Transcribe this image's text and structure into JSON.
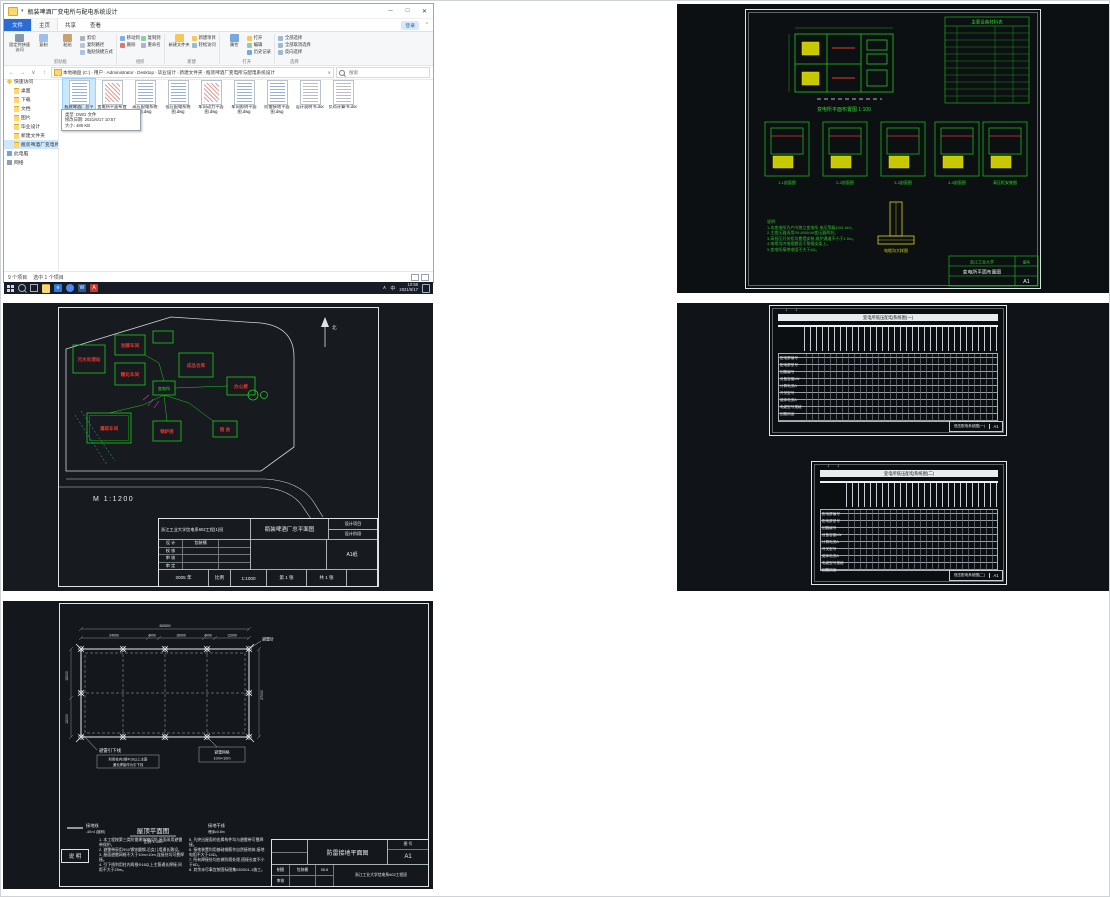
{
  "explorer": {
    "title": "瓶装啤酒厂变电所与配电系统设计",
    "controls": {
      "min": "─",
      "max": "□",
      "close": "✕"
    },
    "tabs": {
      "file": "文件",
      "home": "主页",
      "share": "共享",
      "view": "查看",
      "signin": "登录"
    },
    "ribbon": {
      "pin": "固定到快速访问",
      "copy": "复制",
      "paste": "粘贴",
      "cut": "剪切",
      "copy_path": "复制路径",
      "paste_shortcut": "粘贴快捷方式",
      "move_to": "移动到",
      "copy_to": "复制到",
      "delete": "删除",
      "rename": "重命名",
      "new_folder": "新建文件夹",
      "new_item": "新建项目",
      "easy_access": "轻松访问",
      "properties": "属性",
      "open": "打开",
      "edit": "编辑",
      "history": "历史记录",
      "select_all": "全部选择",
      "select_none": "全部取消选择",
      "invert": "反向选择",
      "groups": [
        "剪贴板",
        "组织",
        "新建",
        "打开",
        "选择"
      ]
    },
    "address": {
      "crumbs": [
        "本地磁盘 (C:)",
        "用户",
        "Administrator",
        "Desktop",
        "毕业设计",
        "新建文件夹",
        "瓶装啤酒厂变电所与配电系统设计"
      ],
      "search_placeholder": "搜索"
    },
    "sidebar": {
      "quick_access": "快速访问",
      "items": [
        {
          "label": "桌面"
        },
        {
          "label": "下载"
        },
        {
          "label": "文档"
        },
        {
          "label": "图片"
        },
        {
          "label": "毕业设计"
        },
        {
          "label": "新建文件夹"
        },
        {
          "label": "瓶装啤酒厂变电所与配电系统设计"
        }
      ],
      "this_pc": "此电脑",
      "network": "网络"
    },
    "files": [
      {
        "name": "瓶装啤酒厂总平面图.dwg"
      },
      {
        "name": "变电所平面布置图.dwg"
      },
      {
        "name": "高压配电系统图.dwg"
      },
      {
        "name": "低压配电系统图.dwg"
      },
      {
        "name": "车间动力平面图.dwg"
      },
      {
        "name": "车间照明平面图.dwg"
      },
      {
        "name": "防雷接地平面图.dwg"
      },
      {
        "name": "设计说明书.doc"
      },
      {
        "name": "负荷计算书.doc"
      }
    ],
    "tooltip": [
      "类型: DWG 文件",
      "修改日期: 2021/6/17 10:57",
      "大小: 486 KB"
    ],
    "status": {
      "count": "9 个项目",
      "selected": "选中 1 个项目"
    }
  },
  "taskbar": {
    "lang": "中",
    "time": "10:58",
    "date": "2021/6/17"
  },
  "substation": {
    "plan_caption": "变电所平面布置图 1:100",
    "table_title": "主要设备材料表",
    "section_captions": [
      "1-1剖面图",
      "2-2剖面图",
      "3-3剖面图",
      "4-4剖面图",
      "高压柜安装图"
    ],
    "detail_caption": "电缆沟大样图",
    "notes": [
      "说明:",
      "1.本变电所为户内独立变电所,电压等级10/0.4kV。",
      "2.主变压器选用S9-800kVA变压器两台。",
      "3.高低压开关柜均靠墙安装,维护通道不小于1.5m。",
      "4.电缆沟内电缆敷设于角钢支架上。",
      "5.变电所接地电阻不大于4Ω。"
    ],
    "titleblock": {
      "school": "浙江工业大学",
      "name": "变电所平面布置图",
      "no_label": "图号",
      "sheet": "A1"
    }
  },
  "siteplan": {
    "north": "北",
    "scale_note": "M  1:1200",
    "labels": {
      "b1": "污水处理站",
      "b2": "发酵车间",
      "b3": "成品仓库",
      "b4": "糖化车间",
      "b5": "办公楼",
      "b6": "灌装车间",
      "b7": "锅炉房",
      "b8": "宿 舍",
      "substation": "变电所"
    },
    "titleblock": {
      "class_line": "浙江工业大学信电系602工程(1)班",
      "drawing_name": "瓶装啤酒厂总平面图",
      "proj_label": "设计项目",
      "stage_label": "设计阶段",
      "rows": [
        {
          "label": "设 计",
          "value": "包装桶"
        },
        {
          "label": "校 核",
          "value": ""
        },
        {
          "label": "审 核",
          "value": ""
        },
        {
          "label": "审 定",
          "value": ""
        }
      ],
      "paper": "A1纸",
      "year": "2005 年",
      "scale_label": "比例",
      "scale_value": "1:1000",
      "sheet_no": "第 1 张",
      "sheet_total": "共 1 张"
    }
  },
  "systems": {
    "sheet1": {
      "band": "变电所低压配电系统图(一)",
      "row_labels": [
        "配电屏编号",
        "配电屏型号",
        "回路编号",
        "设备容量kW",
        "计算电流A",
        "开关型号",
        "熔体电流A",
        "电缆型号规格",
        "回路用途"
      ],
      "tb_name": "低压配电系统图(一)",
      "tb_sheet": "A1"
    },
    "sheet2": {
      "band": "变电所低压配电系统图(二)",
      "row_labels": [
        "配电屏编号",
        "配电屏型号",
        "回路编号",
        "设备容量kW",
        "计算电流A",
        "开关型号",
        "熔体电流A",
        "电缆型号规格",
        "回路用途"
      ],
      "tb_name": "低压配电系统图(二)",
      "tb_sheet": "A1"
    }
  },
  "lightning": {
    "dims": {
      "total": "60000",
      "segments": [
        "24000",
        "4000",
        "16000",
        "4000",
        "12000"
      ],
      "left_top": "15000",
      "left_bottom": "12000",
      "right": "27000"
    },
    "labels": {
      "down_lead": "避雷引下线",
      "down_lead_note1": "利用柱内2根Φ16以上主筋",
      "down_lead_note2": "通长焊接作为引下线",
      "mesh1": "避雷网格",
      "mesh2": "10m×10m",
      "needle": "避雷针",
      "ground_wire": "接地线",
      "ground_wire_spec": "-40×4 (镀锌)",
      "roof_title": "屋顶平面图",
      "roof_scale": "比例 1:100",
      "ground_main": "接地干线",
      "ground_main_spec": "埋深≥0.8m"
    },
    "notes_header": "说 明",
    "notes_left": [
      "1. 本工程按第三类防雷建筑物设防,屋面采用避雷带保护。",
      "2. 避雷带采用Φ10镀锌圆钢,沿女儿墙通长敷设。",
      "3. 屋面避雷网格不大于10m×10m,连接处均可靠焊接。",
      "4. 引下线利用柱内两根Φ16以上主筋通长焊接,间距不大于25m。"
    ],
    "notes_right": [
      "5. 凡突出屋面的金属构件均与避雷带可靠焊接。",
      "6. 接地装置利用基础钢筋作自然接地体,接地电阻不大于10Ω。",
      "7. 所有焊接处均应做防腐处理,搭接长度不小于6D。",
      "8. 其余未尽事宜按国标图集03D501-1施工。"
    ],
    "titleblock": {
      "name": "防雷接地平面图",
      "no_label": "图 号",
      "no_value": "A1",
      "draw_label": "制图",
      "draw_value": "包装桶",
      "date": "05.6",
      "school": "浙江工业大学信电系602工程班",
      "check_label": "审核"
    }
  }
}
